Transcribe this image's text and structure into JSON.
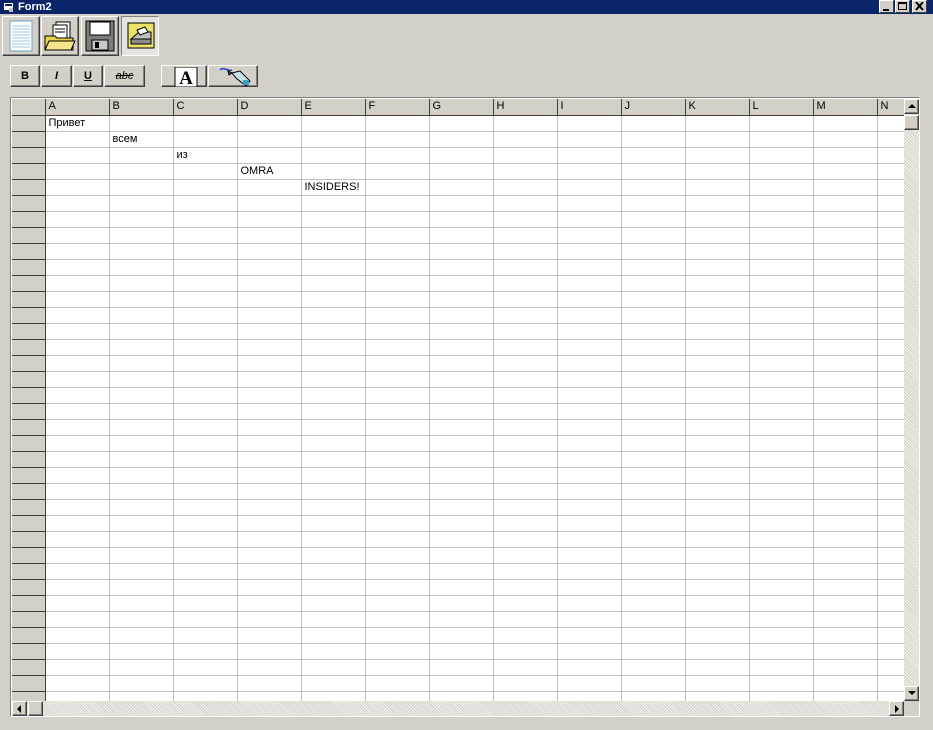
{
  "window": {
    "title": "Form2"
  },
  "toolbar": {
    "buttons": [
      {
        "icon": "new-document-icon"
      },
      {
        "icon": "open-folder-icon"
      },
      {
        "icon": "save-disk-icon"
      },
      {
        "icon": "print-icon"
      }
    ]
  },
  "format": {
    "bold": "B",
    "italic": "I",
    "underline": "U",
    "strike": "abc"
  },
  "grid": {
    "columns": [
      "",
      "A",
      "B",
      "C",
      "D",
      "E",
      "F",
      "G",
      "H",
      "I",
      "J",
      "K",
      "L",
      "M",
      "N"
    ],
    "rows": [
      [
        "Привет",
        "",
        "",
        "",
        "",
        "",
        "",
        "",
        "",
        "",
        "",
        "",
        "",
        ""
      ],
      [
        "",
        "всем",
        "",
        "",
        "",
        "",
        "",
        "",
        "",
        "",
        "",
        "",
        "",
        ""
      ],
      [
        "",
        "",
        "из",
        "",
        "",
        "",
        "",
        "",
        "",
        "",
        "",
        "",
        "",
        ""
      ],
      [
        "",
        "",
        "",
        "OMRA",
        "",
        "",
        "",
        "",
        "",
        "",
        "",
        "",
        "",
        ""
      ],
      [
        "",
        "",
        "",
        "",
        "INSIDERS!",
        "",
        "",
        "",
        "",
        "",
        "",
        "",
        "",
        ""
      ]
    ],
    "empty_row_count": 32
  }
}
